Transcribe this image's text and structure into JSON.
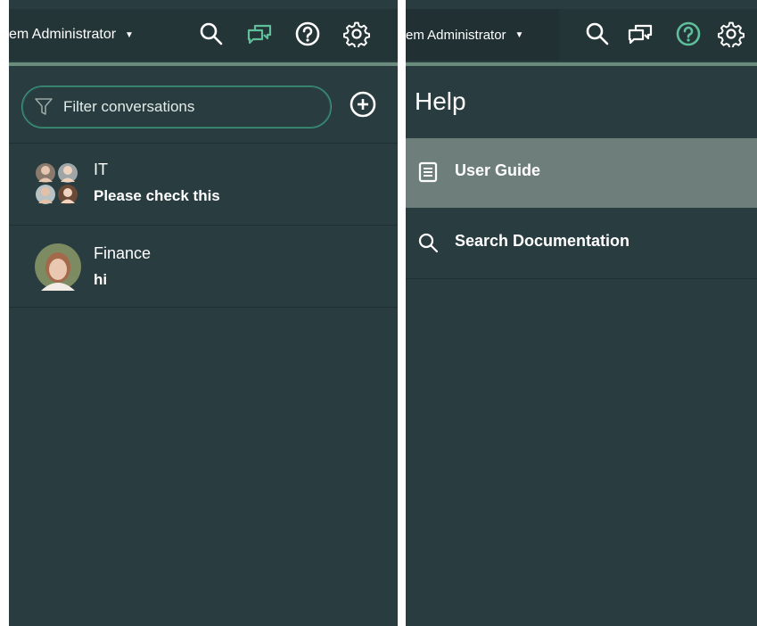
{
  "left_panel": {
    "header": {
      "user_label": "em Administrator",
      "icons": [
        "search-icon",
        "conversations-icon",
        "help-icon",
        "settings-icon"
      ]
    },
    "filter": {
      "placeholder": "Filter conversations"
    },
    "conversations": [
      {
        "title": "IT",
        "message": "Please check this",
        "avatar": "group-avatar"
      },
      {
        "title": "Finance",
        "message": "hi",
        "avatar": "user-avatar"
      }
    ]
  },
  "right_panel": {
    "header": {
      "user_label": "em Administrator",
      "icons": [
        "search-icon",
        "conversations-icon",
        "help-icon",
        "settings-icon"
      ]
    },
    "title": "Help",
    "items": [
      {
        "label": "User Guide",
        "icon": "document-icon",
        "active": true
      },
      {
        "label": "Search Documentation",
        "icon": "search-icon",
        "active": false
      }
    ]
  },
  "colors": {
    "panel_bg": "#293c3f",
    "accent_green": "#6a8c7c",
    "highlight": "#6e7f7b",
    "active_icon": "#5fbf9b"
  }
}
